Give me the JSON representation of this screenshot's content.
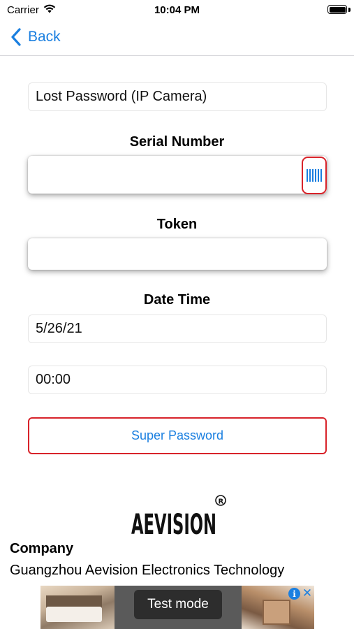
{
  "status_bar": {
    "carrier": "Carrier",
    "time": "10:04 PM",
    "icons": [
      "wifi-icon",
      "battery-icon"
    ]
  },
  "nav": {
    "back_label": "Back",
    "icon": "chevron-left-icon"
  },
  "form": {
    "mode_value": "Lost Password (IP Camera)",
    "serial_label": "Serial Number",
    "serial_value": "",
    "scan_icon": "barcode-icon",
    "token_label": "Token",
    "token_value": "",
    "datetime_label": "Date Time",
    "date_value": "5/26/21",
    "time_value": "00:00",
    "submit_label": "Super Password"
  },
  "company": {
    "logo_text": "AEVISION",
    "title": "Company",
    "name": "Guangzhou Aevision Electronics Technology"
  },
  "ad": {
    "test_mode_label": "Test mode",
    "info_icon": "info-icon",
    "close_icon": "close-icon"
  },
  "colors": {
    "accent": "#1a7fe0",
    "highlight_border": "#d8232a"
  }
}
